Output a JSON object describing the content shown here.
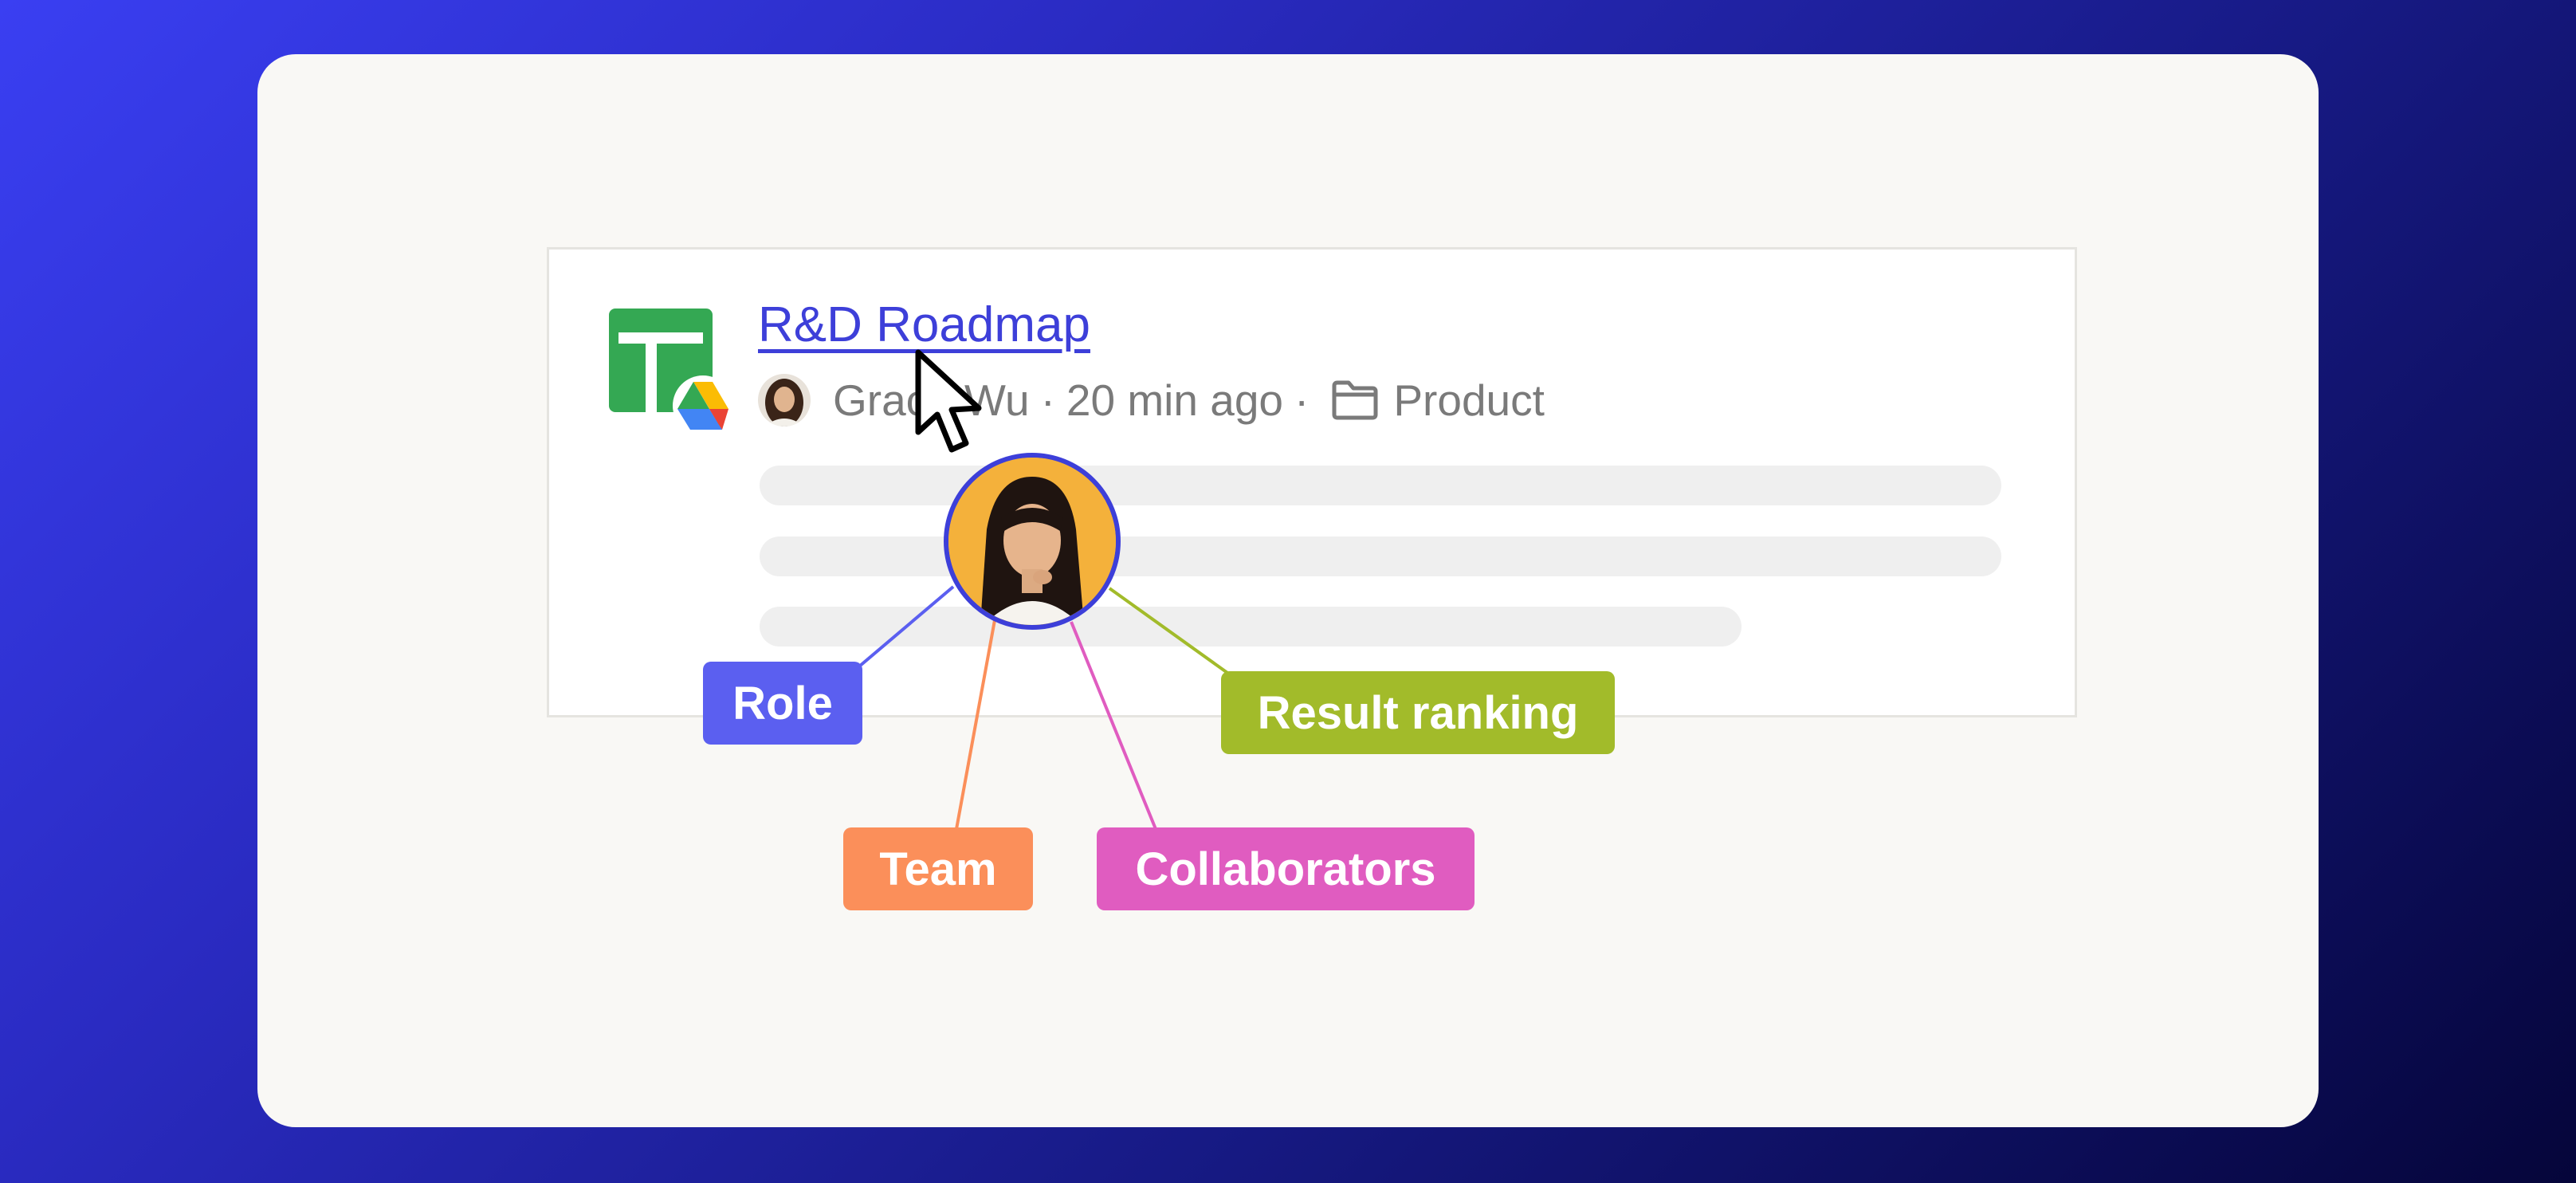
{
  "result": {
    "title": "R&D Roadmap",
    "author": "Grace Wu",
    "separator": "·",
    "time_ago": "20 min ago",
    "folder": "Product"
  },
  "icons": {
    "file_type": "google-sheets-icon",
    "source": "google-drive-icon",
    "folder": "folder-icon",
    "cursor": "mouse-pointer-icon"
  },
  "signals": {
    "role": {
      "label": "Role",
      "color": "#5b5ff0"
    },
    "team": {
      "label": "Team",
      "color": "#fb8f5a"
    },
    "collaborators": {
      "label": "Collaborators",
      "color": "#e05cc0"
    },
    "result_ranking": {
      "label": "Result ranking",
      "color": "#a2bb2a"
    }
  },
  "colors": {
    "link": "#3d3fd9",
    "background_start": "#3a3ff2",
    "background_end": "#05053a",
    "sheets_green": "#34a853"
  }
}
